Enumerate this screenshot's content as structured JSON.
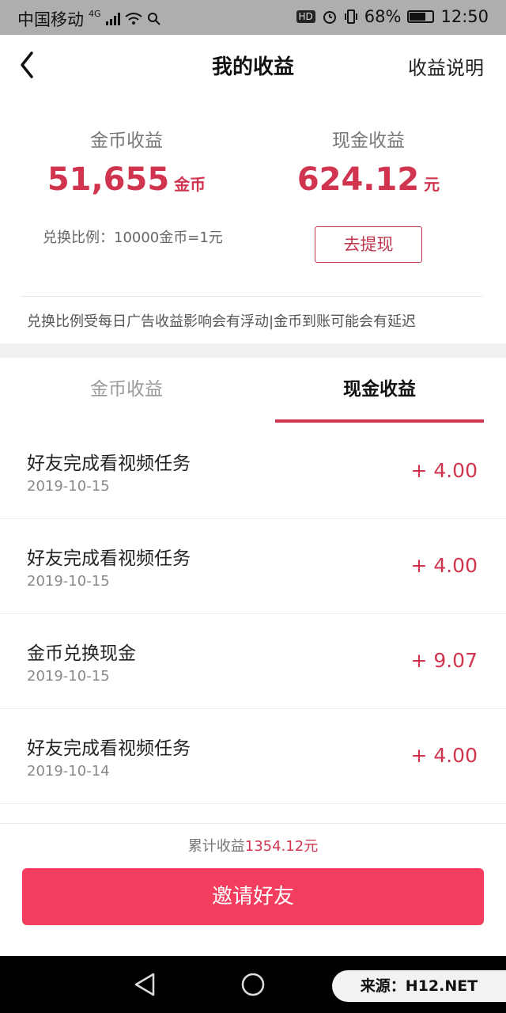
{
  "status_bar": {
    "carrier": "中国移动",
    "network": "4G",
    "battery_text": "68%",
    "battery_level": 0.68,
    "time": "12:50",
    "hd_label": "HD"
  },
  "nav": {
    "back_icon": "chevron-left-icon",
    "title": "我的收益",
    "right_link": "收益说明"
  },
  "summary": {
    "coin_label": "金币收益",
    "coin_amount": "51,655",
    "coin_unit": "金币",
    "cash_label": "现金收益",
    "cash_amount": "624.12",
    "cash_unit": "元",
    "ratio_text": "兑换比例：10000金币=1元",
    "withdraw_button": "去提现",
    "notice": "兑换比例受每日广告收益影响会有浮动|金币到账可能会有延迟"
  },
  "tabs": [
    {
      "label": "金币收益",
      "active": false
    },
    {
      "label": "现金收益",
      "active": true
    }
  ],
  "records": [
    {
      "title": "好友完成看视频任务",
      "date": "2019-10-15",
      "amount": "+ 4.00"
    },
    {
      "title": "好友完成看视频任务",
      "date": "2019-10-15",
      "amount": "+ 4.00"
    },
    {
      "title": "金币兑换现金",
      "date": "2019-10-15",
      "amount": "+ 9.07"
    },
    {
      "title": "好友完成看视频任务",
      "date": "2019-10-14",
      "amount": "+ 4.00"
    }
  ],
  "footer": {
    "total_prefix": "累计收益",
    "total_value": "1354.12元",
    "invite_button": "邀请好友"
  },
  "watermark": "来源：H12.NET",
  "colors": {
    "accent": "#d0344f",
    "button": "#f23d5e",
    "status_bar": "#aeaeae"
  }
}
